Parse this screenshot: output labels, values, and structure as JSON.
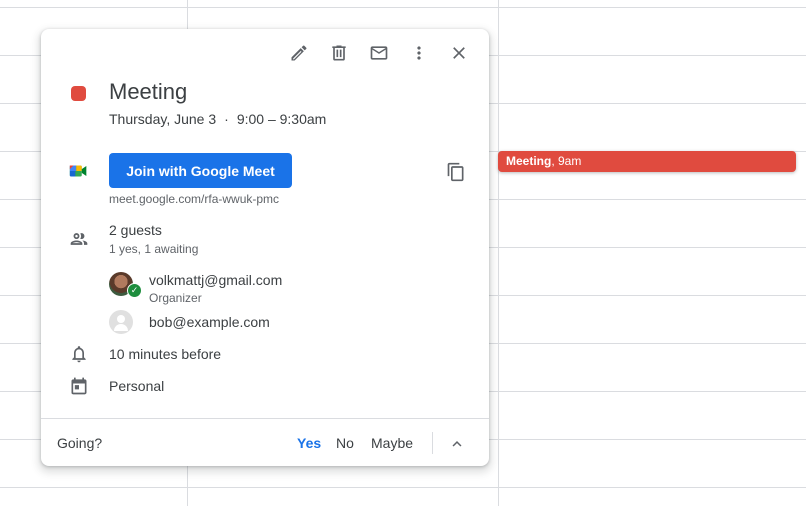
{
  "calendar": {
    "event_chip": {
      "title": "Meeting",
      "time": ", 9am"
    }
  },
  "popup": {
    "toolbar": {
      "edit_icon": "pencil-icon",
      "delete_icon": "trash-icon",
      "email_icon": "mail-icon",
      "more_icon": "more-vert-icon",
      "close_icon": "close-icon"
    },
    "event": {
      "color": "#e04b3f",
      "title": "Meeting",
      "date": "Thursday, June 3",
      "separator": "·",
      "time": "9:00 – 9:30am"
    },
    "conference": {
      "icon": "google-meet-icon",
      "join_label": "Join with Google Meet",
      "link": "meet.google.com/rfa-wwuk-pmc",
      "copy_icon": "copy-icon"
    },
    "guests": {
      "icon": "people-icon",
      "count": "2 guests",
      "summary": "1 yes, 1 awaiting",
      "list": [
        {
          "email": "volkmattj@gmail.com",
          "role": "Organizer",
          "accepted": true
        },
        {
          "email": "bob@example.com",
          "role": "",
          "accepted": false
        }
      ]
    },
    "reminder": {
      "icon": "bell-icon",
      "text": "10 minutes before"
    },
    "calendar": {
      "icon": "calendar-icon",
      "name": "Personal"
    },
    "rsvp": {
      "label": "Going?",
      "yes": "Yes",
      "no": "No",
      "maybe": "Maybe",
      "selected": "Yes",
      "expand_icon": "chevron-up-icon"
    },
    "accent_color": "#1a73e8"
  }
}
